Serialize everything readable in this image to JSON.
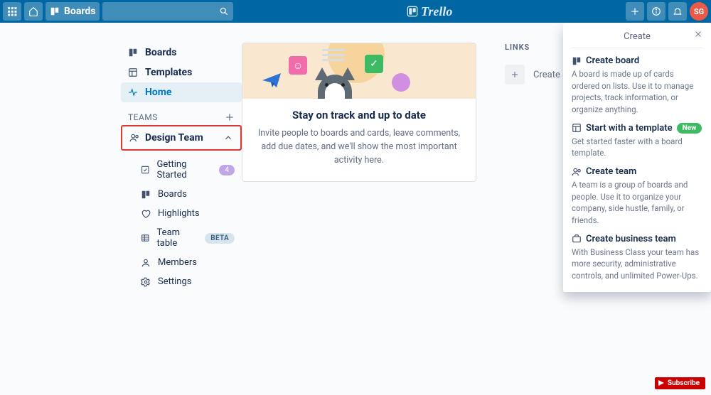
{
  "brand": "Trello",
  "topbar": {
    "boards_label": "Boards",
    "avatar_initials": "SG"
  },
  "sidebar": {
    "nav": {
      "boards": "Boards",
      "templates": "Templates",
      "home": "Home"
    },
    "teams_heading": "TEAMS",
    "team_name": "Design Team",
    "items": {
      "getting_started": {
        "label": "Getting Started",
        "badge": "4"
      },
      "boards": "Boards",
      "highlights": "Highlights",
      "team_table": {
        "label": "Team table",
        "badge": "BETA"
      },
      "members": "Members",
      "settings": "Settings"
    }
  },
  "card": {
    "title": "Stay on track and up to date",
    "body": "Invite people to boards and cards, leave comments, add due dates, and we'll show the most important activity here."
  },
  "rightcol": {
    "links_heading": "LINKS",
    "create_board": "Create a b"
  },
  "create_panel": {
    "title": "Create",
    "options": {
      "board": {
        "title": "Create board",
        "desc": "A board is made up of cards ordered on lists. Use it to manage projects, track information, or organize anything."
      },
      "template": {
        "title": "Start with a template",
        "badge": "New",
        "desc": "Get started faster with a board template."
      },
      "team": {
        "title": "Create team",
        "desc": "A team is a group of boards and people. Use it to organize your company, side hustle, family, or friends."
      },
      "business": {
        "title": "Create business team",
        "desc": "With Business Class your team has more security, administrative controls, and unlimited Power-Ups."
      }
    }
  },
  "subscribe_label": "Subscribe"
}
